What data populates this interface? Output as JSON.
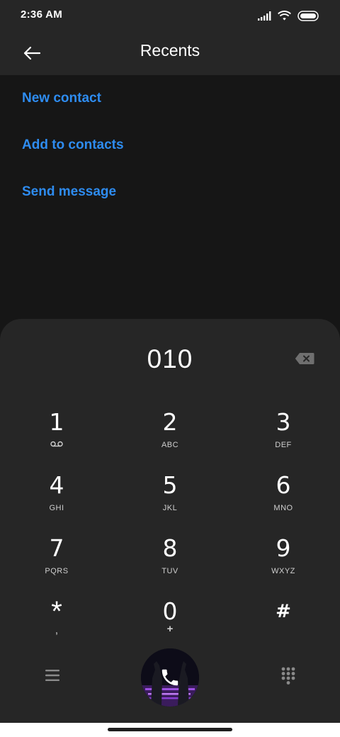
{
  "status_bar": {
    "time": "2:36 AM",
    "icons": [
      "signal-icon",
      "wifi-icon",
      "battery-icon"
    ]
  },
  "header": {
    "title": "Recents",
    "back_icon": "arrow-left-icon"
  },
  "actions": [
    {
      "label": "New contact"
    },
    {
      "label": "Add to contacts"
    },
    {
      "label": "Send message"
    }
  ],
  "dialpad": {
    "number": "010",
    "keys": [
      {
        "digit": "1",
        "letters": ""
      },
      {
        "digit": "2",
        "letters": "ABC"
      },
      {
        "digit": "3",
        "letters": "DEF"
      },
      {
        "digit": "4",
        "letters": "GHI"
      },
      {
        "digit": "5",
        "letters": "JKL"
      },
      {
        "digit": "6",
        "letters": "MNO"
      },
      {
        "digit": "7",
        "letters": "PQRS"
      },
      {
        "digit": "8",
        "letters": "TUV"
      },
      {
        "digit": "9",
        "letters": "WXYZ"
      },
      {
        "digit": "*",
        "letters": ","
      },
      {
        "digit": "0",
        "letters": "+"
      },
      {
        "digit": "#",
        "letters": ""
      }
    ]
  },
  "colors": {
    "accent": "#2e8cf0",
    "background": "#161616",
    "panel": "#262626"
  }
}
